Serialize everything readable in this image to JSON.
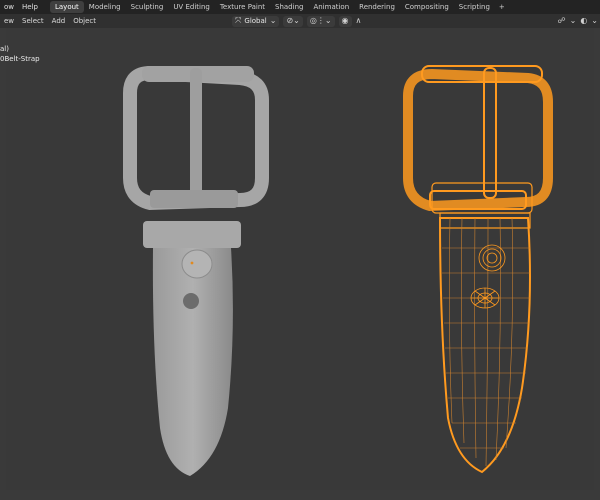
{
  "topbar": {
    "menu": [
      "ow",
      "Help"
    ],
    "tabs": [
      "Layout",
      "Modeling",
      "Sculpting",
      "UV Editing",
      "Texture Paint",
      "Shading",
      "Animation",
      "Rendering",
      "Compositing",
      "Scripting"
    ],
    "active_tab": "Layout",
    "add_tab": "+"
  },
  "header": {
    "menu": [
      "ew",
      "Select",
      "Add",
      "Object"
    ],
    "transform_orientation": "Global",
    "icons": [
      "orientation-icon",
      "pivot-icon",
      "snap-icon",
      "proportional-edit-icon",
      "viewport-gizmo-icon",
      "overlay-icon"
    ]
  },
  "viewport": {
    "overlay_line1": "al)",
    "overlay_line2": "0Belt-Strap"
  },
  "colors": {
    "solid_model": "#a8a8a8",
    "wire_selected": "#ff9a1f",
    "background": "#393939"
  }
}
